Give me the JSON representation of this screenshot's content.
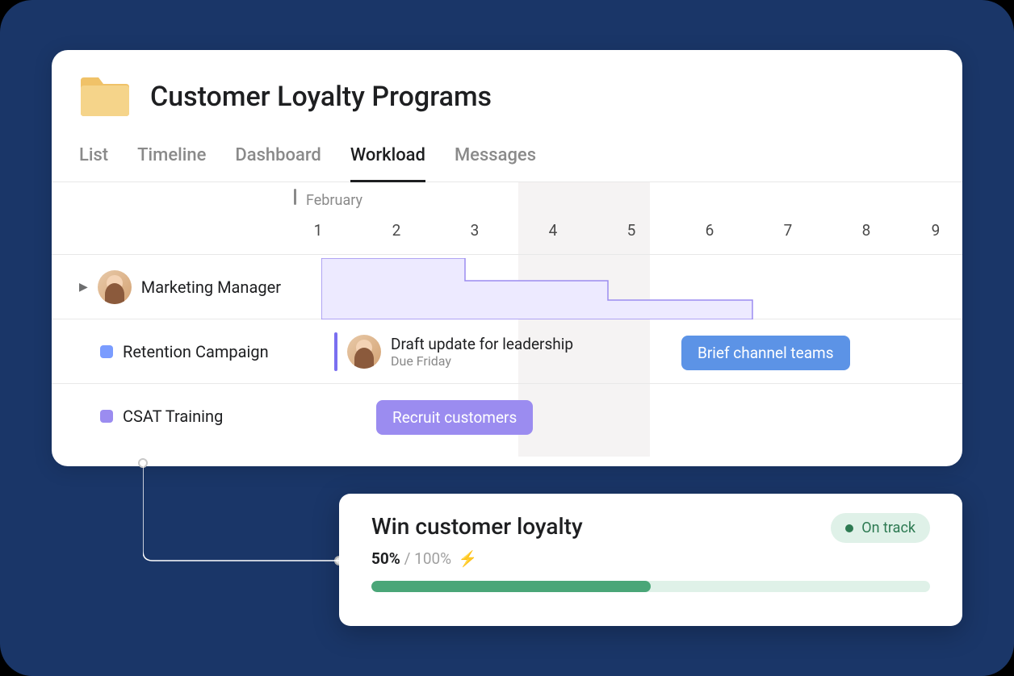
{
  "page": {
    "title": "Customer Loyalty Programs"
  },
  "tabs": [
    {
      "label": "List",
      "active": false
    },
    {
      "label": "Timeline",
      "active": false
    },
    {
      "label": "Dashboard",
      "active": false
    },
    {
      "label": "Workload",
      "active": true
    },
    {
      "label": "Messages",
      "active": false
    }
  ],
  "timeline": {
    "month": "February",
    "days": [
      1,
      2,
      3,
      4,
      5,
      6,
      7,
      8,
      9
    ],
    "today_range": [
      4,
      5
    ]
  },
  "rows": [
    {
      "type": "person",
      "label": "Marketing Manager"
    },
    {
      "type": "project",
      "label": "Retention Campaign",
      "color": "#7a9cff",
      "tasks": [
        {
          "title": "Draft update for leadership",
          "due": "Due Friday",
          "start": 2
        },
        {
          "title": "Brief channel teams",
          "pill_color": "#5c93e6",
          "start": 6
        }
      ]
    },
    {
      "type": "project",
      "label": "CSAT Training",
      "color": "#9b8cf0",
      "tasks": [
        {
          "title": "Recruit customers",
          "pill_color": "#9b8cf0",
          "start": 2
        }
      ]
    }
  ],
  "goal": {
    "title": "Win customer loyalty",
    "current": "50%",
    "target": "100%",
    "progress_pct": 50,
    "status": "On track"
  }
}
